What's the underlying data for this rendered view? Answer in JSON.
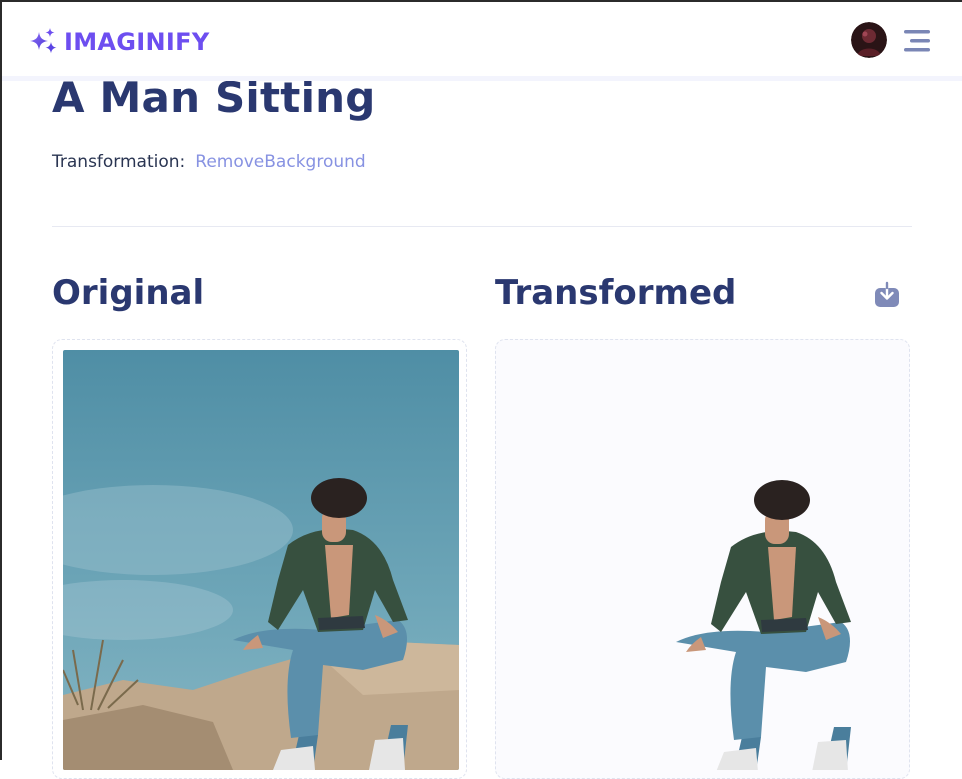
{
  "app": {
    "name": "IMAGINIFY",
    "logo_icon": "sparkle-icon",
    "menu_icon": "hamburger-menu-icon"
  },
  "image": {
    "title": "A Man Sitting",
    "transformation_label": "Transformation:",
    "transformation_type": "RemoveBackground"
  },
  "sections": {
    "original_title": "Original",
    "transformed_title": "Transformed",
    "download_icon": "download-icon"
  },
  "colors": {
    "brand_purple": "#6d4ef0",
    "heading_navy": "#2a3870",
    "accent_light_purple": "#8792e2"
  }
}
